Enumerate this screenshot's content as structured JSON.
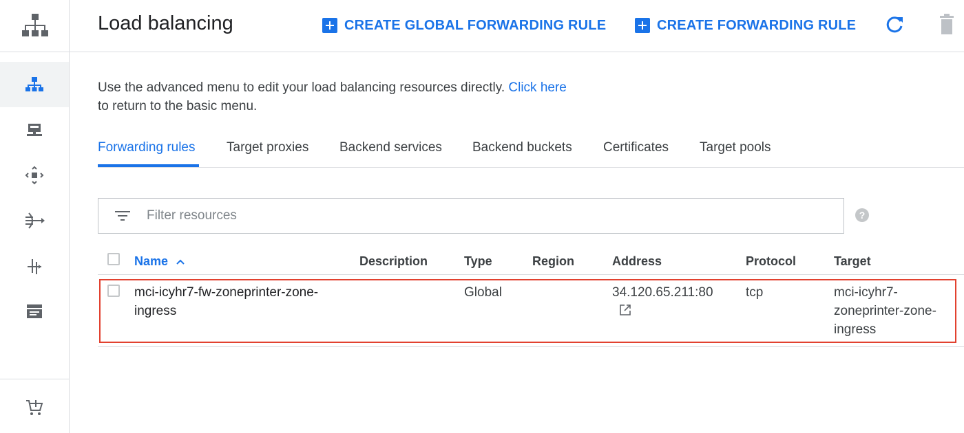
{
  "header": {
    "title": "Load balancing",
    "create_global_label": "CREATE GLOBAL FORWARDING RULE",
    "create_rule_label": "CREATE FORWARDING RULE"
  },
  "rail": {
    "items": [
      "network-services-logo",
      "load-balancing-icon",
      "compute-icon",
      "cloud-dns-icon",
      "traffic-director-icon",
      "cdn-icon",
      "service-directory-icon",
      "marketplace-icon"
    ]
  },
  "intro": {
    "text": "Use the advanced menu to edit your load balancing resources directly. ",
    "link": "Click here",
    "text_after": "to return to the basic menu."
  },
  "tabs": [
    {
      "label": "Forwarding rules",
      "active": true
    },
    {
      "label": "Target proxies"
    },
    {
      "label": "Backend services"
    },
    {
      "label": "Backend buckets"
    },
    {
      "label": "Certificates"
    },
    {
      "label": "Target pools"
    }
  ],
  "filter": {
    "placeholder": "Filter resources"
  },
  "table": {
    "headers": {
      "name": "Name",
      "description": "Description",
      "type": "Type",
      "region": "Region",
      "address": "Address",
      "protocol": "Protocol",
      "target": "Target"
    },
    "rows": [
      {
        "name_line1": "mci-icyhr7-fw-zoneprinter-zone-",
        "name_line2": "ingress",
        "description": "",
        "type": "Global",
        "region": "",
        "address": "34.120.65.211:80",
        "protocol": "tcp",
        "target_line1": "mci-icyhr7-",
        "target_line2": "zoneprinter-zone-",
        "target_line3": "ingress"
      }
    ]
  },
  "colors": {
    "accent": "#1a73e8",
    "highlight": "#e2412f",
    "icon": "#5f6368"
  }
}
